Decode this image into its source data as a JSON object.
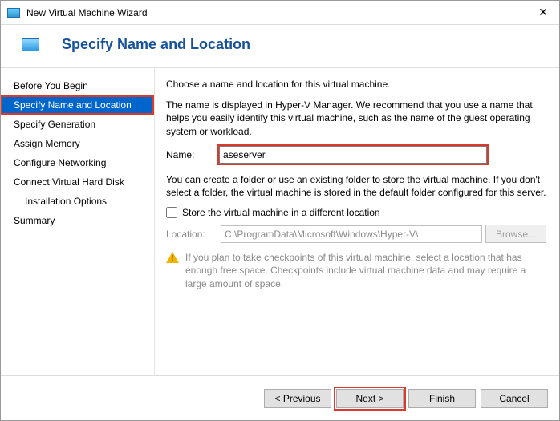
{
  "window": {
    "title": "New Virtual Machine Wizard"
  },
  "header": {
    "title": "Specify Name and Location"
  },
  "sidebar": {
    "steps": [
      "Before You Begin",
      "Specify Name and Location",
      "Specify Generation",
      "Assign Memory",
      "Configure Networking",
      "Connect Virtual Hard Disk",
      "Installation Options",
      "Summary"
    ]
  },
  "main": {
    "intro": "Choose a name and location for this virtual machine.",
    "desc": "The name is displayed in Hyper-V Manager. We recommend that you use a name that helps you easily identify this virtual machine, such as the name of the guest operating system or workload.",
    "name_label": "Name:",
    "name_value": "aseserver",
    "folder_desc": "You can create a folder or use an existing folder to store the virtual machine. If you don't select a folder, the virtual machine is stored in the default folder configured for this server.",
    "store_diff": "Store the virtual machine in a different location",
    "location_label": "Location:",
    "location_value": "C:\\ProgramData\\Microsoft\\Windows\\Hyper-V\\",
    "browse": "Browse...",
    "warning": "If you plan to take checkpoints of this virtual machine, select a location that has enough free space. Checkpoints include virtual machine data and may require a large amount of space."
  },
  "footer": {
    "previous": "< Previous",
    "next": "Next >",
    "finish": "Finish",
    "cancel": "Cancel"
  }
}
